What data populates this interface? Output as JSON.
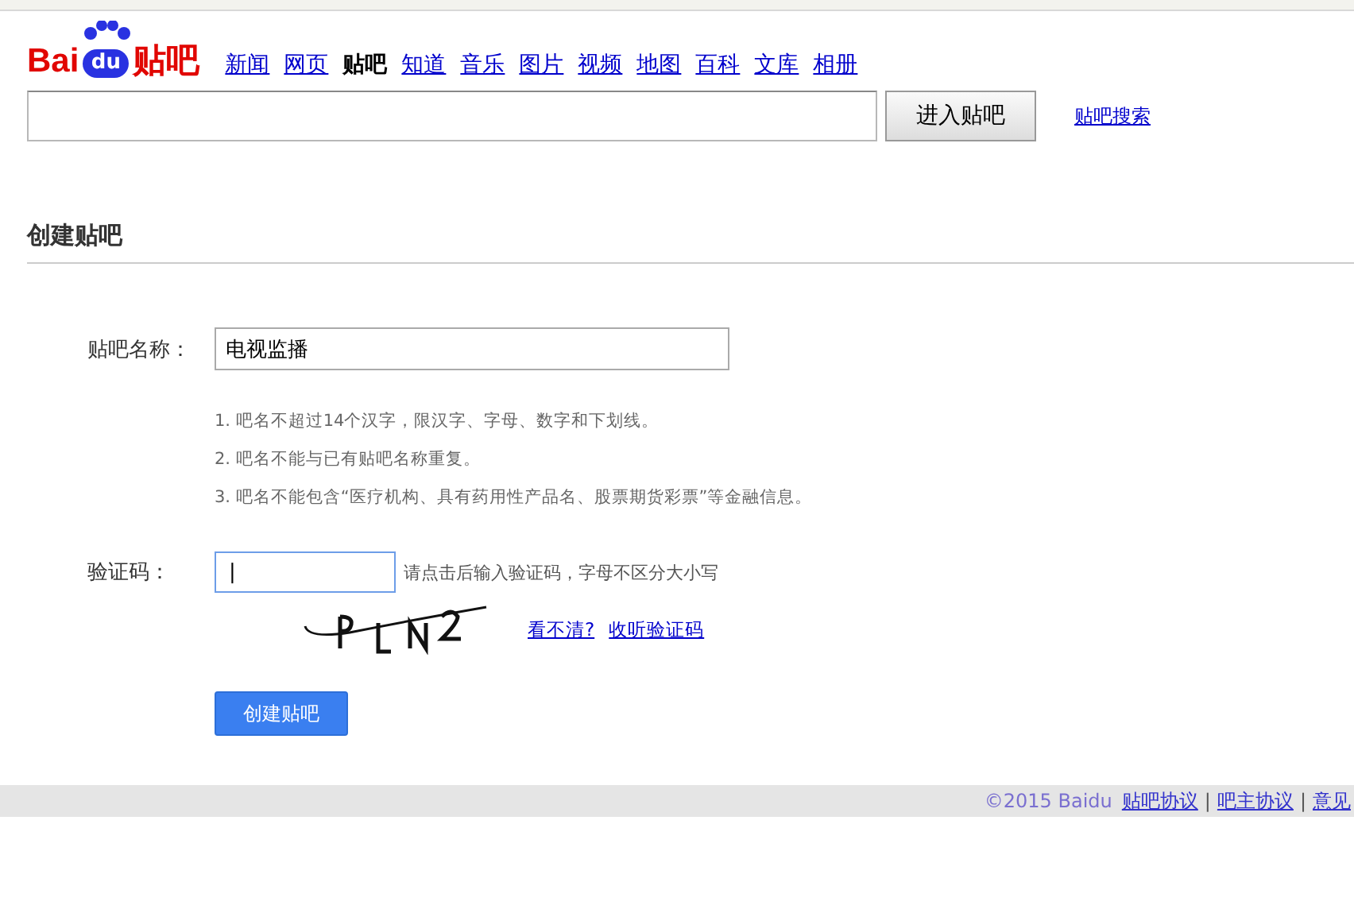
{
  "logo": {
    "part_1": "Bai",
    "part_2": "du",
    "part_3": "贴吧"
  },
  "nav": [
    {
      "label": "新闻",
      "selected": false
    },
    {
      "label": "网页",
      "selected": false
    },
    {
      "label": "贴吧",
      "selected": true
    },
    {
      "label": "知道",
      "selected": false
    },
    {
      "label": "音乐",
      "selected": false
    },
    {
      "label": "图片",
      "selected": false
    },
    {
      "label": "视频",
      "selected": false
    },
    {
      "label": "地图",
      "selected": false
    },
    {
      "label": "百科",
      "selected": false
    },
    {
      "label": "文库",
      "selected": false
    },
    {
      "label": "相册",
      "selected": false
    }
  ],
  "search": {
    "button": "进入贴吧",
    "link": "贴吧搜索"
  },
  "section_title": "创建贴吧",
  "form": {
    "name_label": "贴吧名称：",
    "name_value": "电视监播",
    "rules": [
      "1. 吧名不超过14个汉字，限汉字、字母、数字和下划线。",
      "2. 吧名不能与已有贴吧名称重复。",
      "3. 吧名不能包含“医疗机构、具有药用性产品名、股票期货彩票”等金融信息。"
    ],
    "captcha_label": "验证码：",
    "captcha_value": "|",
    "captcha_hint": "请点击后输入验证码，字母不区分大小写",
    "captcha_links": [
      "看不清?",
      "收听验证码"
    ],
    "submit": "创建贴吧"
  },
  "footer": {
    "copyright": "©2015 Baidu",
    "items": [
      {
        "kind": "link",
        "text": "贴吧协议"
      },
      {
        "kind": "separator",
        "text": "|"
      },
      {
        "kind": "link",
        "text": "吧主协议"
      },
      {
        "kind": "separator",
        "text": "|"
      },
      {
        "kind": "link",
        "text": "意见"
      }
    ]
  }
}
